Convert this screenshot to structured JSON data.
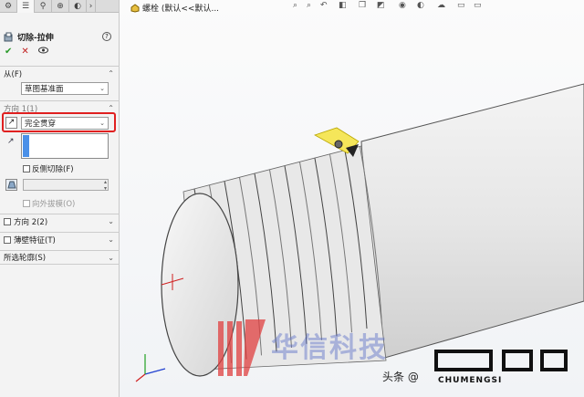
{
  "tabs": [
    "feature-manager",
    "property-manager",
    "configuration-manager",
    "dimxpert-manager",
    "display-manager"
  ],
  "panel": {
    "title": "切除-拉伸",
    "help": "?",
    "actions": {
      "ok": "✔",
      "cancel": "✕",
      "preview": "👁"
    }
  },
  "from": {
    "section_label": "从(F)",
    "value": "草图基准面"
  },
  "direction1": {
    "section_label": "方向 1(1)",
    "end_condition": "完全贯穿",
    "flip_side_label": "反侧切除(F)",
    "draft_label": "向外拔模(O)"
  },
  "direction2": {
    "label": "方向 2(2)"
  },
  "thin_feature": {
    "label": "薄壁特征(T)"
  },
  "selected_contours": {
    "label": "所选轮廓(S)"
  },
  "viewport": {
    "tree_label": "螺栓 (默认<<默认..."
  },
  "watermark": {
    "chinese": "华信科技",
    "site": "头条 @",
    "brand": "CHUMENGSI"
  },
  "colors": {
    "accent": "#e02020",
    "selection": "#4a90e8",
    "highlight": "#f5e65a"
  }
}
